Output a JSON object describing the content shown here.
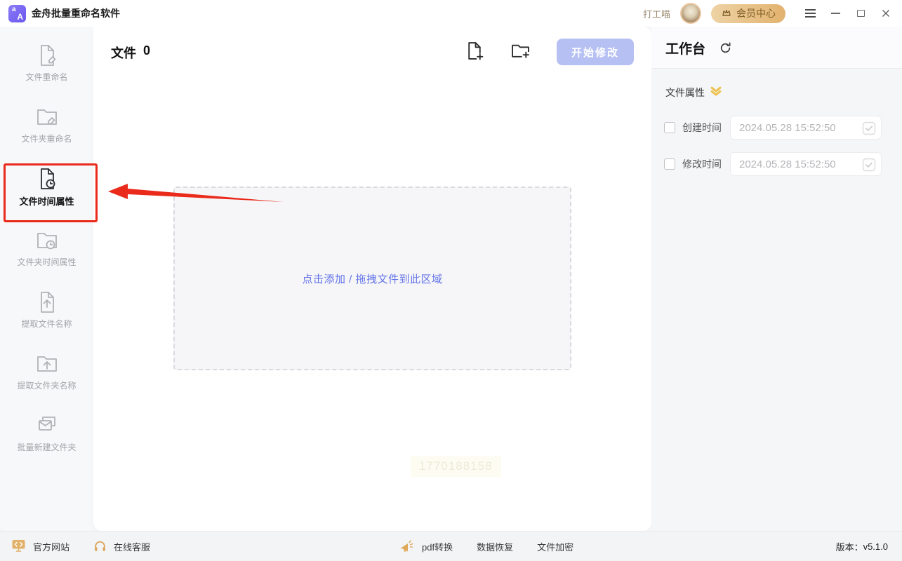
{
  "title_bar": {
    "app_title": "金舟批量重命名软件",
    "username": "打工喵",
    "member_button": "会员中心"
  },
  "sidebar": {
    "items": [
      {
        "label": "文件重命名",
        "icon": "file-rename-icon",
        "selected": false
      },
      {
        "label": "文件夹重命名",
        "icon": "folder-rename-icon",
        "selected": false
      },
      {
        "label": "文件时间属性",
        "icon": "file-time-icon",
        "selected": true
      },
      {
        "label": "文件夹时间属性",
        "icon": "folder-time-icon",
        "selected": false
      },
      {
        "label": "提取文件名称",
        "icon": "extract-file-name-icon",
        "selected": false
      },
      {
        "label": "提取文件夹名称",
        "icon": "extract-folder-name-icon",
        "selected": false
      },
      {
        "label": "批量新建文件夹",
        "icon": "batch-new-folder-icon",
        "selected": false
      }
    ]
  },
  "main": {
    "file_count_label": "文件",
    "file_count": "0",
    "start_button": "开始修改",
    "dropzone_text": "点击添加 / 拖拽文件到此区域",
    "watermark": "1770188158"
  },
  "workbench": {
    "title": "工作台",
    "section_title": "文件属性",
    "rows": [
      {
        "label": "创建时间",
        "value": "2024.05.28 15:52:50",
        "checked": false
      },
      {
        "label": "修改时间",
        "value": "2024.05.28 15:52:50",
        "checked": false
      }
    ]
  },
  "footer": {
    "official_site": "官方网站",
    "online_service": "在线客服",
    "promo_links": [
      "pdf转换",
      "数据恢复",
      "文件加密"
    ],
    "version_label": "版本：",
    "version": "v5.1.0"
  },
  "colors": {
    "brand_purple": "#6a57ee",
    "start_button_bg": "#b7c0f3",
    "dropzone_link_blue": "#6474e8",
    "gold_accent": "#dfa958",
    "annotation_red": "#ea2a1a"
  }
}
